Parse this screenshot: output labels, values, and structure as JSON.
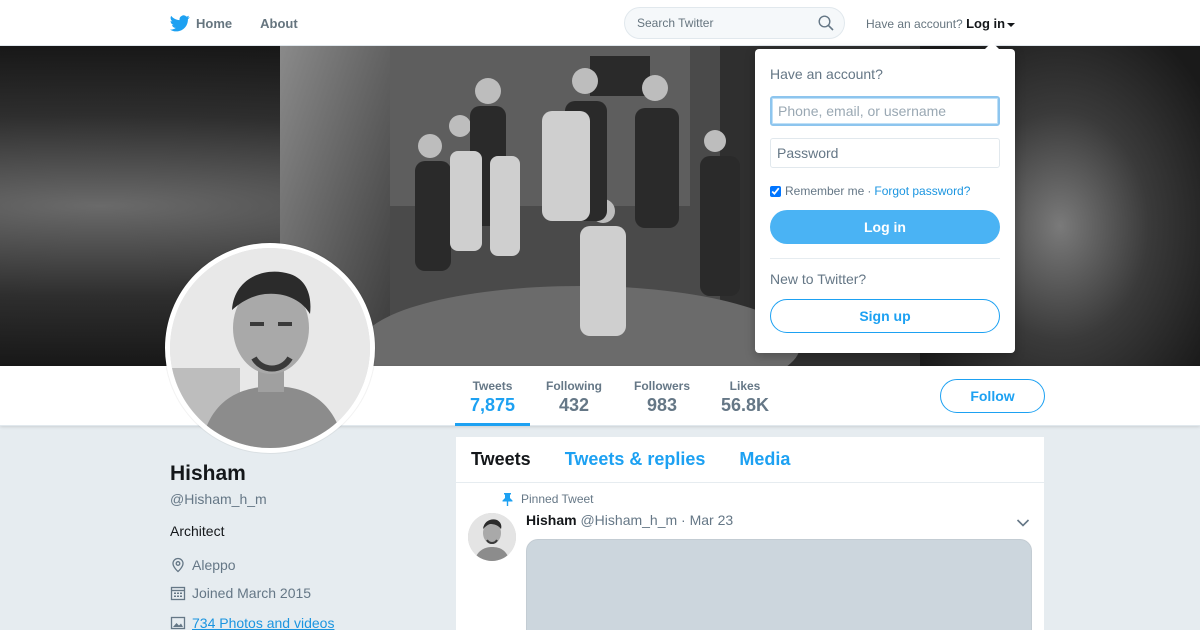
{
  "nav": {
    "logo_icon": "twitter-bird-icon",
    "home_label": "Home",
    "about_label": "About",
    "search_placeholder": "Search Twitter",
    "have_account": "Have an account?",
    "login_label": "Log in"
  },
  "colors": {
    "brand": "#1da1f2",
    "login_button": "#4ab3f4",
    "link": "#1b95e0",
    "muted_text": "#657786",
    "page_bg": "#e6ecf0"
  },
  "profile": {
    "name": "Hisham",
    "handle": "@Hisham_h_m",
    "bio": "Architect",
    "location": "Aleppo",
    "joined": "Joined March 2015",
    "photos_link": "734 Photos and videos"
  },
  "stats": [
    {
      "label": "Tweets",
      "value": "7,875",
      "active": true
    },
    {
      "label": "Following",
      "value": "432",
      "active": false
    },
    {
      "label": "Followers",
      "value": "983",
      "active": false
    },
    {
      "label": "Likes",
      "value": "56.8K",
      "active": false
    }
  ],
  "follow_label": "Follow",
  "timeline": {
    "tabs": [
      {
        "label": "Tweets",
        "active": true
      },
      {
        "label": "Tweets & replies",
        "active": false
      },
      {
        "label": "Media",
        "active": false
      }
    ],
    "pinned_label": "Pinned Tweet",
    "tweet": {
      "name": "Hisham",
      "handle": "@Hisham_h_m",
      "separator": "·",
      "date": "Mar 23"
    }
  },
  "login_dropdown": {
    "title": "Have an account?",
    "username_placeholder": "Phone, email, or username",
    "password_placeholder": "Password",
    "remember_label": "Remember me",
    "separator": "·",
    "forgot_label": "Forgot password?",
    "login_button": "Log in",
    "new_label": "New to Twitter?",
    "signup_button": "Sign up"
  }
}
